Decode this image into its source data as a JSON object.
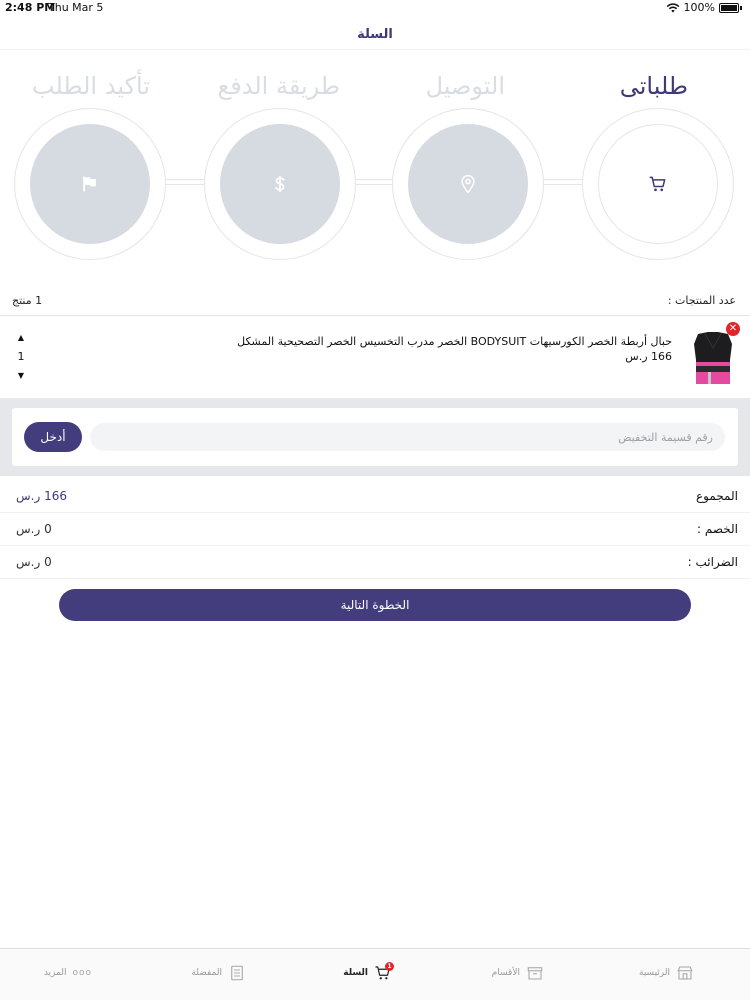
{
  "status_bar": {
    "time": "2:48 PM",
    "date": "Thu Mar 5",
    "battery": "100%"
  },
  "header": {
    "title": "السلة"
  },
  "steps": [
    {
      "label": "طلباتى",
      "icon": "cart-icon",
      "active": true
    },
    {
      "label": "التوصيل",
      "icon": "location-pin-icon",
      "active": false
    },
    {
      "label": "طريقة الدفع",
      "icon": "dollar-icon",
      "active": false
    },
    {
      "label": "تأكيد الطلب",
      "icon": "flag-icon",
      "active": false
    }
  ],
  "cart": {
    "count_label": "عدد المنتجات :",
    "count_value": "1 منتج",
    "items": [
      {
        "name": "حبال أربطة الخصر الكورسيهات BODYSUIT الخصر مدرب التخسيس الخصر التصحيحية المشكل",
        "price": "166 ر.س",
        "quantity": "1",
        "up_glyph": "▲",
        "down_glyph": "▼",
        "remove_glyph": "✕"
      }
    ]
  },
  "coupon": {
    "placeholder": "رقم قسيمة التخفيض",
    "apply_label": "أدخل"
  },
  "summary": {
    "total_label": "المجموع",
    "total_value": "166 ر.س",
    "discount_label": "الخصم :",
    "discount_value": "0 ر.س",
    "tax_label": "الضرائب :",
    "tax_value": "0 ر.س"
  },
  "next_button": "الخطوة التالية",
  "tab_bar": {
    "home": "الرئيسية",
    "categories": "الأقسام",
    "cart": "السلة",
    "cart_badge": "1",
    "favorites": "المفضلة",
    "more": "المزيد",
    "more_glyph": "ooo"
  },
  "colors": {
    "primary": "#433d7e",
    "step_inactive": "#d6dbe1",
    "badge": "#e0262b"
  }
}
